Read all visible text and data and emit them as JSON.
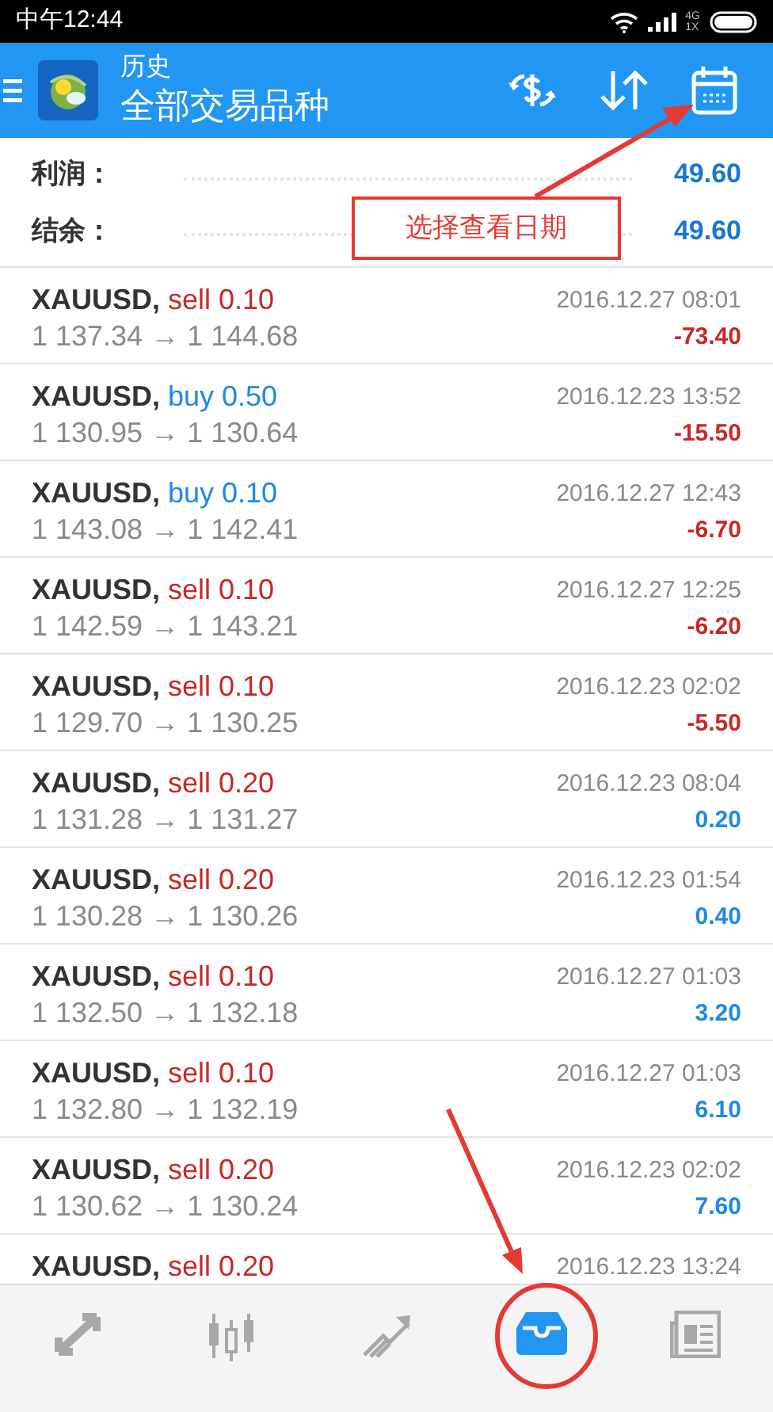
{
  "status_bar": {
    "time": "中午12:44",
    "network": [
      "4G",
      "1X"
    ]
  },
  "app_bar": {
    "title": "历史",
    "subtitle": "全部交易品种"
  },
  "summary": [
    {
      "label": "利润：",
      "value": "49.60"
    },
    {
      "label": "结余：",
      "value": "49.60"
    }
  ],
  "trades": [
    {
      "symbol": "XAUUSD,",
      "kind": "sell",
      "order": "sell 0.10",
      "prices": "1 137.34 → 1 144.68",
      "time": "2016.12.27 08:01",
      "profit": "-73.40",
      "loss": true
    },
    {
      "symbol": "XAUUSD,",
      "kind": "buy",
      "order": "buy 0.50",
      "prices": "1 130.95 → 1 130.64",
      "time": "2016.12.23 13:52",
      "profit": "-15.50",
      "loss": true
    },
    {
      "symbol": "XAUUSD,",
      "kind": "buy",
      "order": "buy 0.10",
      "prices": "1 143.08 → 1 142.41",
      "time": "2016.12.27 12:43",
      "profit": "-6.70",
      "loss": true
    },
    {
      "symbol": "XAUUSD,",
      "kind": "sell",
      "order": "sell 0.10",
      "prices": "1 142.59 → 1 143.21",
      "time": "2016.12.27 12:25",
      "profit": "-6.20",
      "loss": true
    },
    {
      "symbol": "XAUUSD,",
      "kind": "sell",
      "order": "sell 0.10",
      "prices": "1 129.70 → 1 130.25",
      "time": "2016.12.23 02:02",
      "profit": "-5.50",
      "loss": true
    },
    {
      "symbol": "XAUUSD,",
      "kind": "sell",
      "order": "sell 0.20",
      "prices": "1 131.28 → 1 131.27",
      "time": "2016.12.23 08:04",
      "profit": "0.20",
      "loss": false
    },
    {
      "symbol": "XAUUSD,",
      "kind": "sell",
      "order": "sell 0.20",
      "prices": "1 130.28 → 1 130.26",
      "time": "2016.12.23 01:54",
      "profit": "0.40",
      "loss": false
    },
    {
      "symbol": "XAUUSD,",
      "kind": "sell",
      "order": "sell 0.10",
      "prices": "1 132.50 → 1 132.18",
      "time": "2016.12.27 01:03",
      "profit": "3.20",
      "loss": false
    },
    {
      "symbol": "XAUUSD,",
      "kind": "sell",
      "order": "sell 0.10",
      "prices": "1 132.80 → 1 132.19",
      "time": "2016.12.27 01:03",
      "profit": "6.10",
      "loss": false
    },
    {
      "symbol": "XAUUSD,",
      "kind": "sell",
      "order": "sell 0.20",
      "prices": "1 130.62 → 1 130.24",
      "time": "2016.12.23 02:02",
      "profit": "7.60",
      "loss": false
    },
    {
      "symbol": "XAUUSD,",
      "kind": "sell",
      "order": "sell 0.20",
      "time": "2016.12.23 13:24"
    }
  ],
  "bottom_nav": [
    {
      "selected": false
    },
    {
      "selected": false
    },
    {
      "selected": false
    },
    {
      "selected": true
    },
    {
      "selected": false
    }
  ],
  "annotations": {
    "callout": "选择查看日期",
    "marks": [
      {
        "kind": "arrow"
      },
      {
        "kind": "arrow"
      },
      {
        "kind": "circle"
      }
    ]
  }
}
